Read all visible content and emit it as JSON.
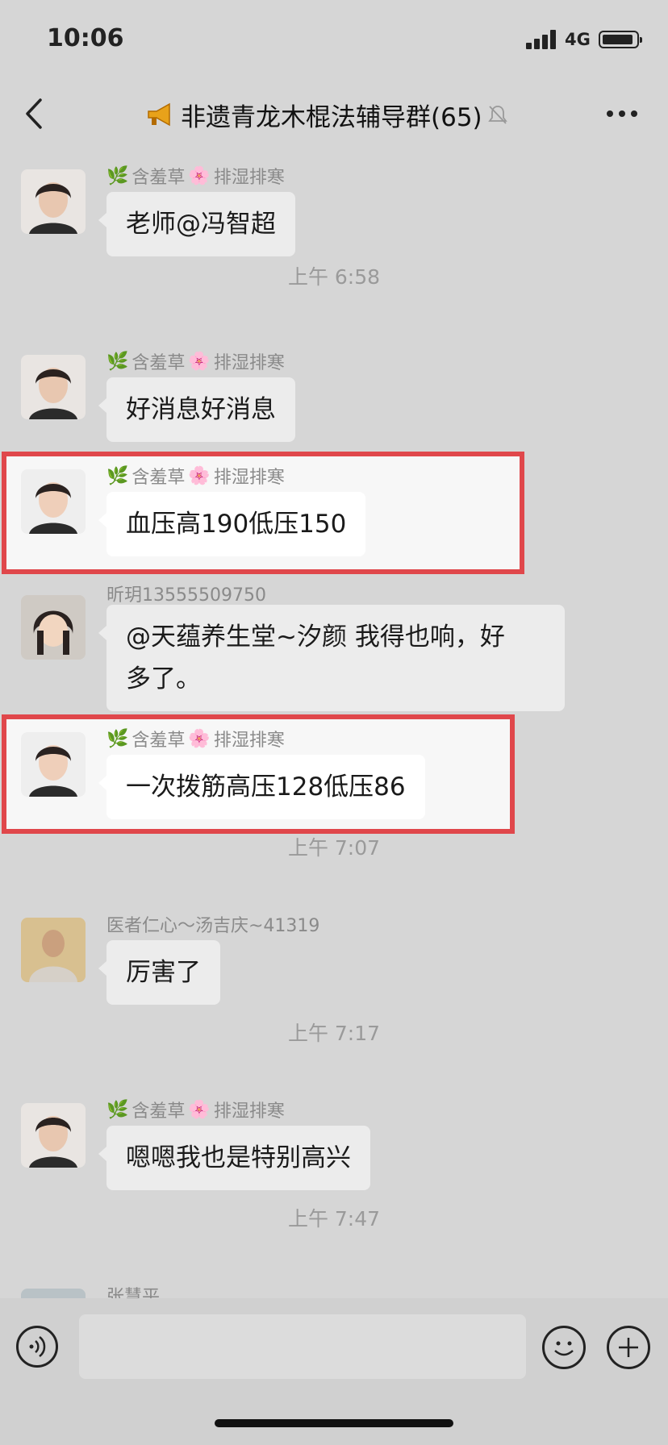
{
  "status_bar": {
    "time": "10:06",
    "network": "4G"
  },
  "header": {
    "title": "非遗青龙木棍法辅导群(65)"
  },
  "messages": [
    {
      "type": "message",
      "sender": "含羞草",
      "sender_suffix": "排湿排寒",
      "text": "老师@冯智超"
    },
    {
      "type": "time",
      "text": "上午 6:58"
    },
    {
      "type": "message",
      "sender": "含羞草",
      "sender_suffix": "排湿排寒",
      "text": "好消息好消息"
    },
    {
      "type": "message",
      "sender": "含羞草",
      "sender_suffix": "排湿排寒",
      "text": "血压高190低压150",
      "highlighted": true
    },
    {
      "type": "message",
      "sender": "昕玥13555509750",
      "text_line1": "@天蕴养生堂~汐颜 我得也响，好",
      "text_line2": "多了。"
    },
    {
      "type": "message",
      "sender": "含羞草",
      "sender_suffix": "排湿排寒",
      "text": "一次拨筋高压128低压86",
      "highlighted": true
    },
    {
      "type": "time",
      "text": "上午 7:07"
    },
    {
      "type": "message",
      "sender": "医者仁心～汤吉庆~41319",
      "text": "厉害了"
    },
    {
      "type": "time",
      "text": "上午 7:17"
    },
    {
      "type": "message",
      "sender": "含羞草",
      "sender_suffix": "排湿排寒",
      "text": "嗯嗯我也是特别高兴"
    },
    {
      "type": "time",
      "text": "上午 7:47"
    },
    {
      "type": "message",
      "sender": "张慧平"
    }
  ],
  "colors": {
    "highlight_border": "#e0474b",
    "background": "#d6d6d6",
    "bubble": "#ececec"
  }
}
